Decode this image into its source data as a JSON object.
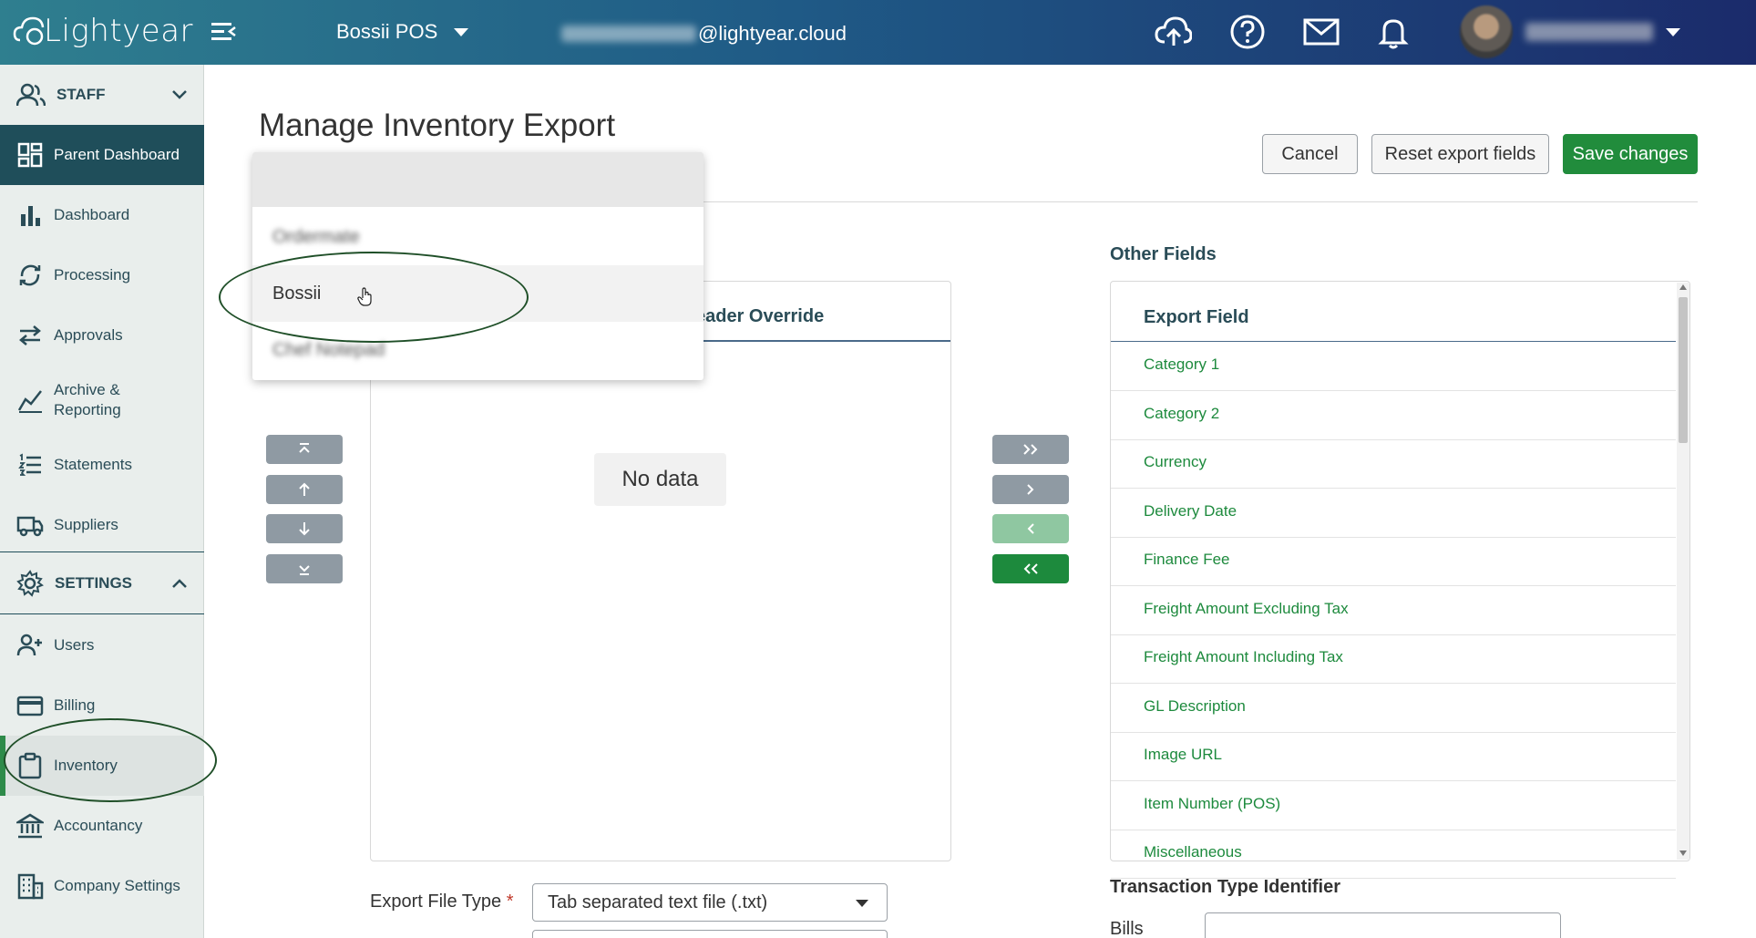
{
  "header": {
    "logo_text": "Lightyear",
    "org_name": "Bossii POS",
    "email_domain": "@lightyear.cloud"
  },
  "sidebar": {
    "staff_section": "STAFF",
    "settings_section": "SETTINGS",
    "items": {
      "parent_dashboard": "Parent Dashboard",
      "dashboard": "Dashboard",
      "processing": "Processing",
      "approvals": "Approvals",
      "archive_reporting": "Archive & Reporting",
      "statements": "Statements",
      "suppliers": "Suppliers",
      "users": "Users",
      "billing": "Billing",
      "inventory": "Inventory",
      "accountancy": "Accountancy",
      "company_settings": "Company Settings"
    }
  },
  "main": {
    "title": "Manage Inventory Export",
    "buttons": {
      "cancel": "Cancel",
      "reset": "Reset export fields",
      "save": "Save changes"
    },
    "selected_panel": {
      "header_override": "eader Override",
      "empty_text": "No data"
    },
    "other_fields": {
      "label": "Other Fields",
      "column_header": "Export Field",
      "rows": [
        "Category 1",
        "Category 2",
        "Currency",
        "Delivery Date",
        "Finance Fee",
        "Freight Amount Excluding Tax",
        "Freight Amount Including Tax",
        "GL Description",
        "Image URL",
        "Item Number (POS)",
        "Miscellaneous"
      ]
    },
    "form": {
      "export_file_type_label": "Export File Type",
      "required_mark": "*",
      "export_file_type_value": "Tab separated text file (.txt)",
      "transaction_type_label": "Transaction Type Identifier",
      "bills_label": "Bills"
    }
  },
  "dropdown": {
    "options": [
      "Ordermate",
      "Bossii",
      "Chef Notepad"
    ]
  },
  "colors": {
    "brand_green": "#1d8a3d",
    "sidebar_active": "#1f4e5a",
    "header_start": "#2f7f8f",
    "header_end": "#1b2b6b"
  }
}
